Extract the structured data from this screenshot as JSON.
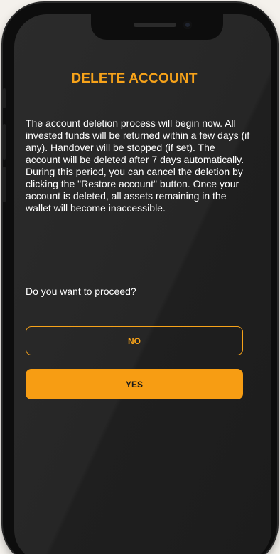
{
  "dialog": {
    "title": "DELETE ACCOUNT",
    "message": "The account deletion process will begin now. All invested funds will be returned within a few days (if any). Handover will be stopped (if set). The account will be deleted after 7 days automatically. During this period, you can cancel the deletion by clicking the \"Restore account\" button. Once your account is deleted, all assets remaining in the wallet will become inaccessible.",
    "question": "Do you want to proceed?",
    "no_label": "NO",
    "yes_label": "YES"
  },
  "colors": {
    "accent": "#f7a31a",
    "screen_background": "#262626",
    "text": "#ffffff"
  }
}
